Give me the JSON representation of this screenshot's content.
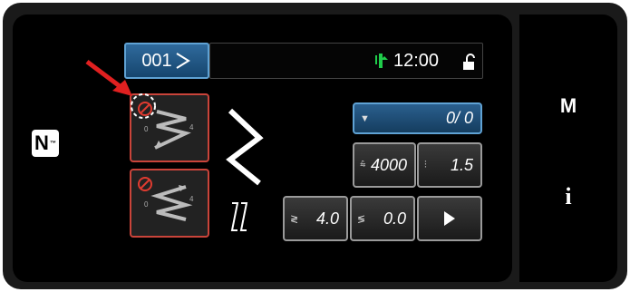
{
  "header": {
    "pattern_number": "001",
    "clock": "12:00"
  },
  "nfc": {
    "label": "N",
    "tm": "™"
  },
  "buttons": {
    "counter": "0/ 0",
    "max_speed": "4000",
    "stitch_ratio": "1.5",
    "stitch_length": "4.0",
    "condensation": "0.0"
  },
  "sidebar": {
    "m_label": "M",
    "info_label": "i"
  },
  "colors": {
    "accent_blue": "#2f6a9c",
    "warning_red": "#c9443a",
    "annotation_red": "#e02020"
  }
}
